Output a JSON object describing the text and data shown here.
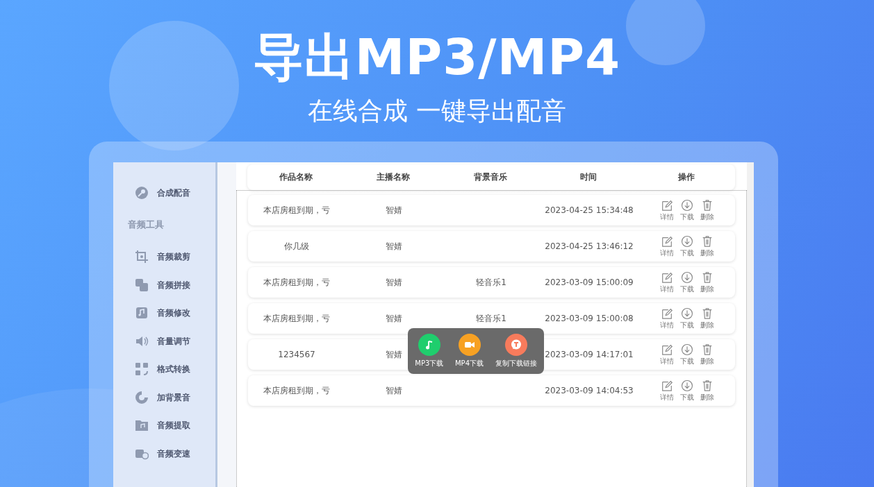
{
  "headline": "导出MP3/MP4",
  "subtitle": "在线合成 一键导出配音",
  "sidebar": {
    "items": [
      {
        "kind": "item",
        "label": "合成配音"
      },
      {
        "kind": "heading",
        "label": "音频工具"
      },
      {
        "kind": "item",
        "label": "音频裁剪"
      },
      {
        "kind": "item",
        "label": "音频拼接"
      },
      {
        "kind": "item",
        "label": "音频修改"
      },
      {
        "kind": "item",
        "label": "音量调节"
      },
      {
        "kind": "item",
        "label": "格式转换"
      },
      {
        "kind": "item",
        "label": "加背景音"
      },
      {
        "kind": "item",
        "label": "音频提取"
      },
      {
        "kind": "item",
        "label": "音频变速"
      }
    ]
  },
  "table": {
    "columns": [
      "作品名称",
      "主播名称",
      "背景音乐",
      "时间",
      "操作"
    ],
    "rows": [
      {
        "cells": [
          "本店房租到期，亏",
          "智婧",
          "",
          "2023-04-25 15:34:48"
        ],
        "actions": [
          "详情",
          "下载",
          "删除"
        ]
      },
      {
        "cells": [
          "你几级",
          "智婧",
          "",
          "2023-04-25 13:46:12"
        ],
        "actions": [
          "详情",
          "下载",
          "删除"
        ]
      },
      {
        "cells": [
          "本店房租到期，亏",
          "智婧",
          "轻音乐1",
          "2023-03-09 15:00:09"
        ],
        "actions": [
          "详情",
          "下载",
          "删除"
        ]
      },
      {
        "cells": [
          "本店房租到期，亏",
          "智婧",
          "轻音乐1",
          "2023-03-09 15:00:08"
        ],
        "actions": [
          "详情",
          "下载",
          "删除"
        ]
      },
      {
        "cells": [
          "1234567",
          "智婧",
          "",
          "2023-03-09 14:17:01"
        ],
        "actions": [
          "详情",
          "下载",
          "删除"
        ]
      },
      {
        "cells": [
          "本店房租到期，亏",
          "智婧",
          "",
          "2023-03-09 14:04:53"
        ],
        "actions": [
          "详情",
          "下载",
          "删除"
        ]
      }
    ]
  },
  "download_menu": {
    "items": [
      {
        "label": "MP3下载",
        "color": "#1fce6d"
      },
      {
        "label": "MP4下载",
        "color": "#f7a123"
      },
      {
        "label": "复制下载链接",
        "color": "#f77b5c"
      }
    ]
  }
}
